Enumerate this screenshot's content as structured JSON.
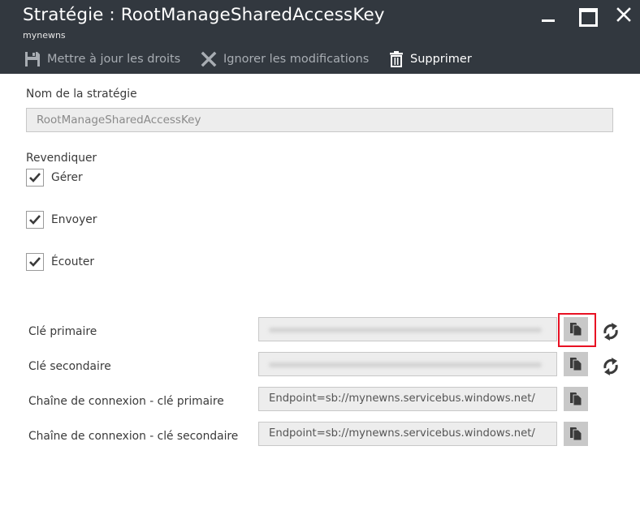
{
  "header": {
    "title": "Stratégie : RootManageSharedAccessKey",
    "subtitle": "mynewns",
    "background": "#32383f",
    "commands": {
      "update": "Mettre à jour les droits",
      "discard": "Ignorer les modifications",
      "delete": "Supprimer"
    }
  },
  "form": {
    "policy_name_label": "Nom de la stratégie",
    "policy_name_value": "RootManageSharedAccessKey",
    "claims_label": "Revendiquer",
    "claims": [
      {
        "label": "Gérer",
        "checked": true
      },
      {
        "label": "Envoyer",
        "checked": true
      },
      {
        "label": "Écouter",
        "checked": true
      }
    ],
    "keys": [
      {
        "label": "Clé primaire",
        "value": "",
        "masked": true,
        "refresh": true
      },
      {
        "label": "Clé secondaire",
        "value": "",
        "masked": true,
        "refresh": true
      },
      {
        "label": "Chaîne de connexion - clé primaire",
        "value": "Endpoint=sb://mynewns.servicebus.windows.net/",
        "masked": false,
        "refresh": false
      },
      {
        "label": "Chaîne de connexion - clé secondaire",
        "value": "Endpoint=sb://mynewns.servicebus.windows.net/",
        "masked": false,
        "refresh": false
      }
    ],
    "highlight_color": "#e81123"
  }
}
